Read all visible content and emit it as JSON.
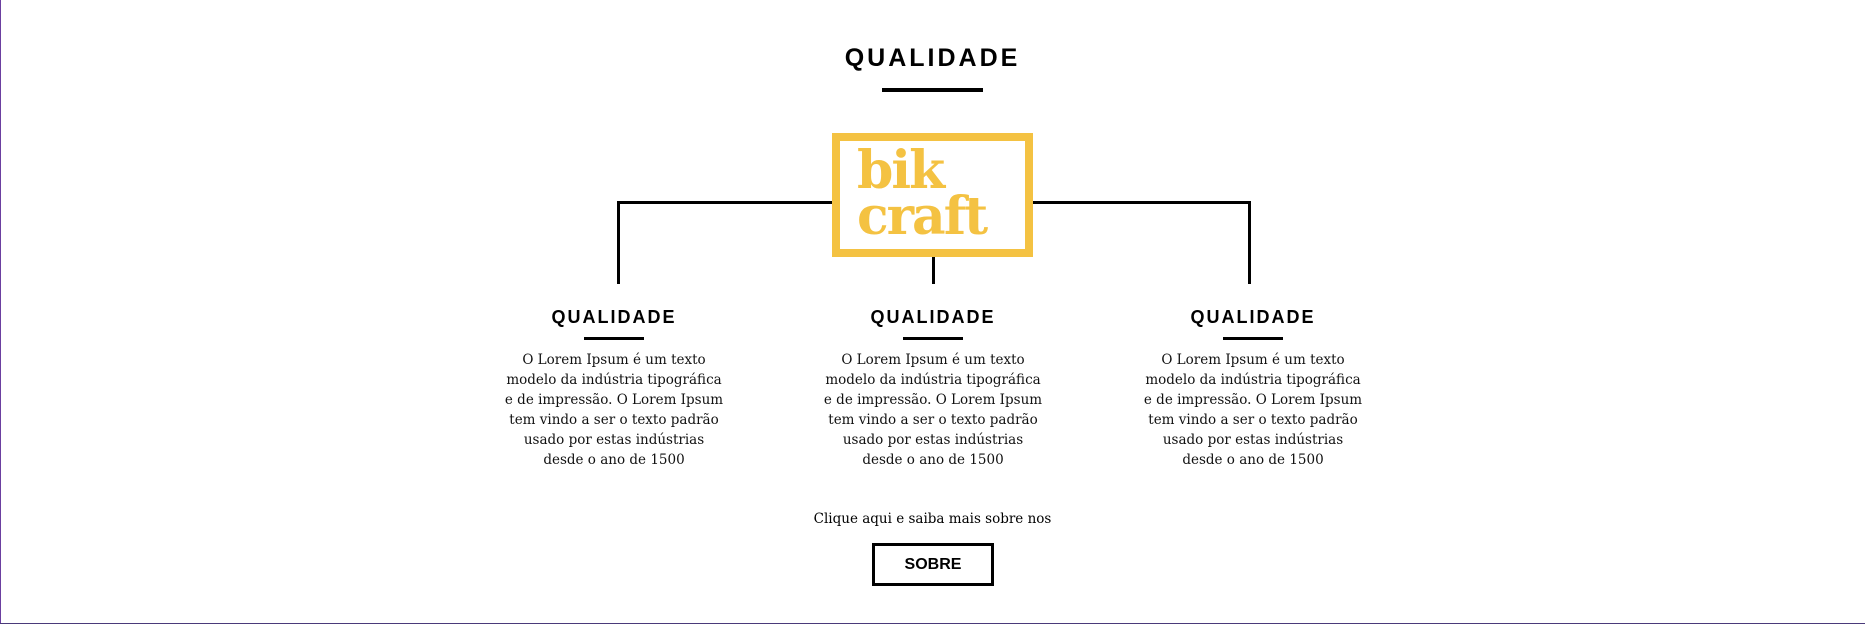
{
  "section": {
    "title": "QUALIDADE"
  },
  "logo": {
    "line1": "bik",
    "line2": "craft",
    "color": "#f4c242"
  },
  "columns": [
    {
      "title": "QUALIDADE",
      "text": "O Lorem Ipsum é um texto modelo da indústria tipográfica e de impressão. O Lorem Ipsum tem vindo a ser o texto padrão usado por estas indústrias desde o ano de 1500"
    },
    {
      "title": "QUALIDADE",
      "text": "O Lorem Ipsum é um texto modelo da indústria tipográfica e de impressão. O Lorem Ipsum tem vindo a ser o texto padrão usado por estas indústrias desde o ano de 1500"
    },
    {
      "title": "QUALIDADE",
      "text": "O Lorem Ipsum é um texto modelo da indústria tipográfica e de impressão. O Lorem Ipsum tem vindo a ser o texto padrão usado por estas indústrias desde o ano de 1500"
    }
  ],
  "cta": {
    "text": "Clique aqui e saiba mais sobre nos",
    "button_label": "SOBRE"
  }
}
